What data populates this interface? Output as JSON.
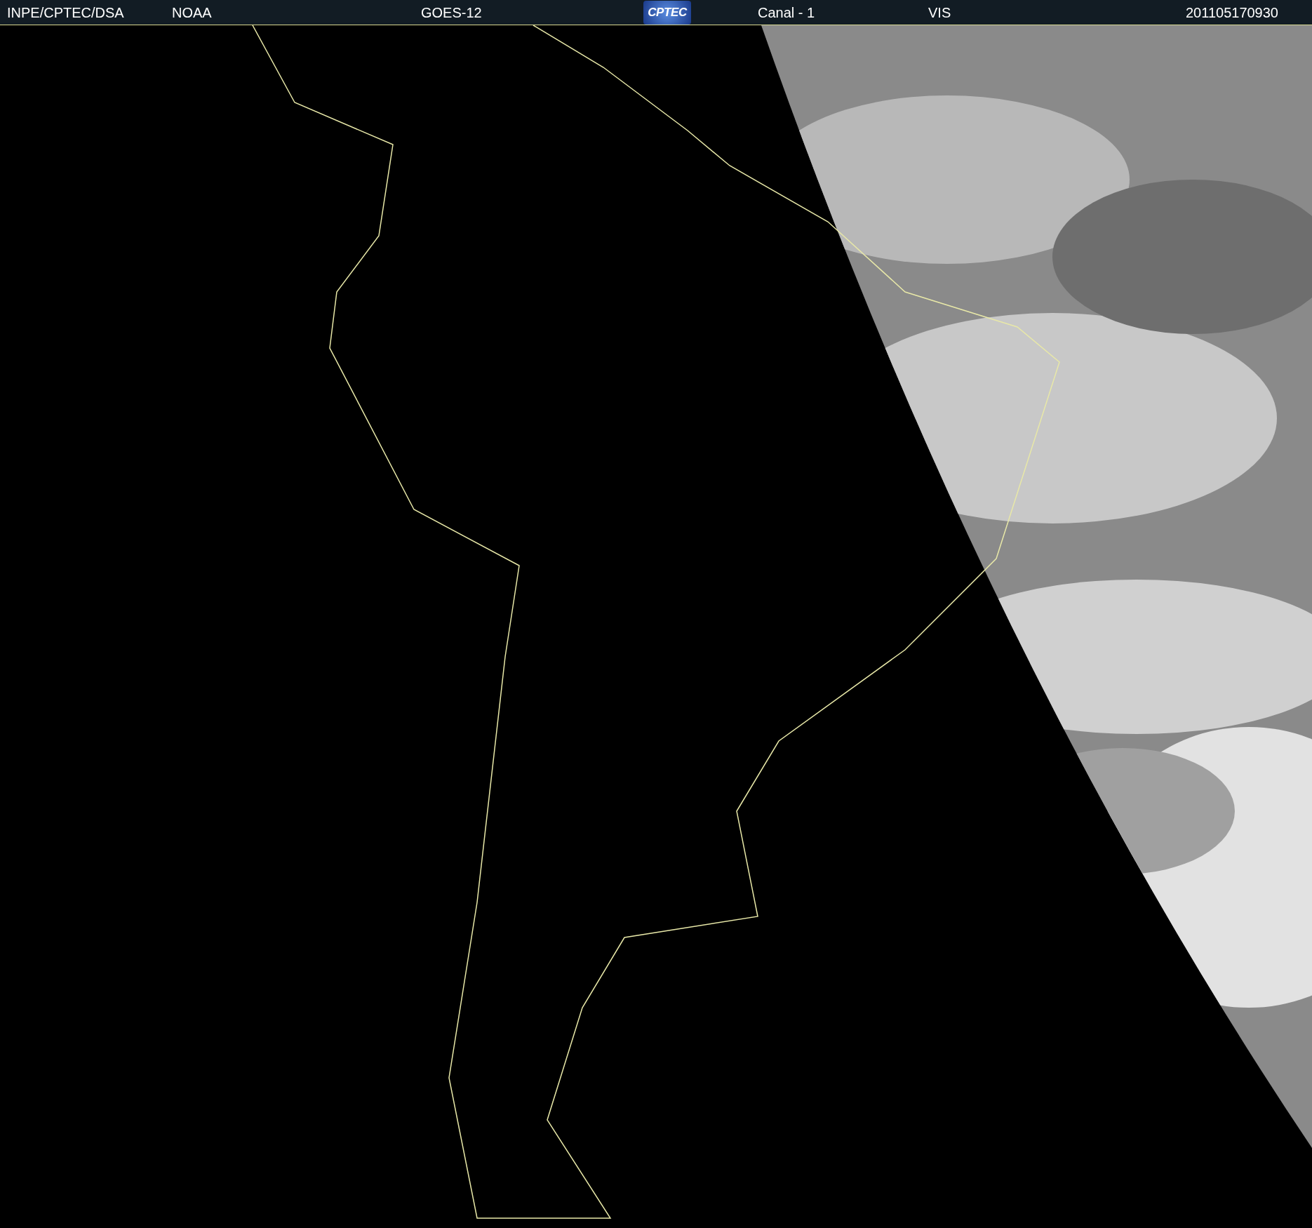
{
  "header": {
    "items": [
      {
        "kind": "text",
        "text": "INPE/CPTEC/DSA"
      },
      {
        "kind": "text",
        "text": "NOAA"
      },
      {
        "kind": "text",
        "text": "GOES-12"
      },
      {
        "kind": "logo",
        "text": "CPTEC"
      },
      {
        "kind": "text",
        "text": "Canal - 1"
      },
      {
        "kind": "text",
        "text": "VIS"
      },
      {
        "kind": "text",
        "text": "201105170930"
      }
    ]
  }
}
